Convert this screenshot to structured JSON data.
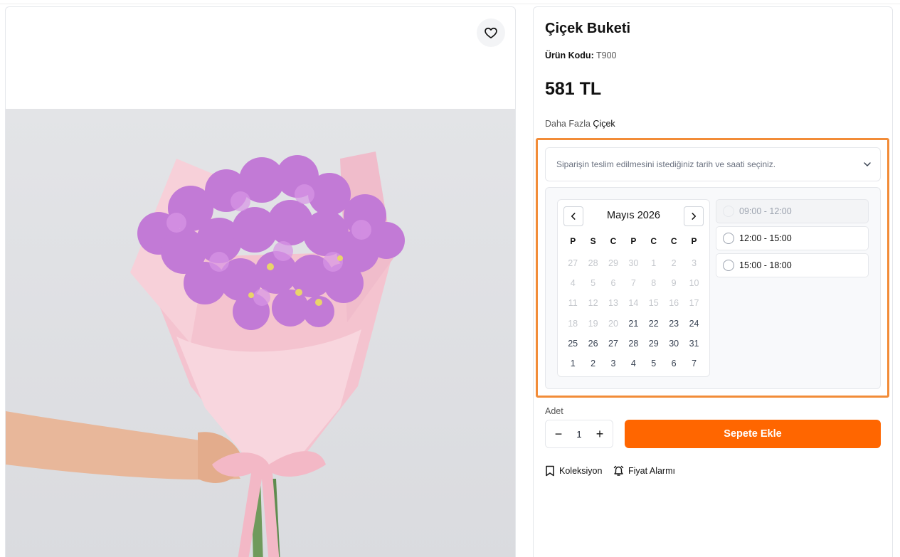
{
  "product": {
    "title": "Çiçek Buketi",
    "code_label": "Ürün Kodu:",
    "code_value": "T900",
    "price": "581 TL",
    "more_prefix": "Daha Fazla",
    "more_link": "Çiçek"
  },
  "favorite": {
    "icon": "heart-icon"
  },
  "delivery": {
    "placeholder": "Siparişin teslim edilmesini istediğiniz tarih ve saati seçiniz.",
    "month_label": "Mayıs 2026",
    "weekdays": [
      "P",
      "S",
      "C",
      "P",
      "C",
      "C",
      "P"
    ],
    "days": [
      [
        27,
        28,
        29,
        30,
        1,
        2,
        3
      ],
      [
        4,
        5,
        6,
        7,
        8,
        9,
        10
      ],
      [
        11,
        12,
        13,
        14,
        15,
        16,
        17
      ],
      [
        18,
        19,
        20,
        21,
        22,
        23,
        24
      ],
      [
        25,
        26,
        27,
        28,
        29,
        30,
        31
      ],
      [
        1,
        2,
        3,
        4,
        5,
        6,
        7
      ]
    ],
    "first_available_day": 21,
    "time_slots": [
      {
        "label": "09:00 - 12:00",
        "available": false
      },
      {
        "label": "12:00 - 15:00",
        "available": true
      },
      {
        "label": "15:00 - 18:00",
        "available": true
      }
    ]
  },
  "quantity": {
    "label": "Adet",
    "value": "1",
    "minus": "−",
    "plus": "+"
  },
  "cart": {
    "button_label": "Sepete Ekle"
  },
  "actions": {
    "collection": "Koleksiyon",
    "price_alarm": "Fiyat Alarmı"
  },
  "colors": {
    "accent": "#ff6600",
    "highlight": "#f28c38",
    "flower": "#c27ad6",
    "wrap": "#f6c9d3"
  }
}
